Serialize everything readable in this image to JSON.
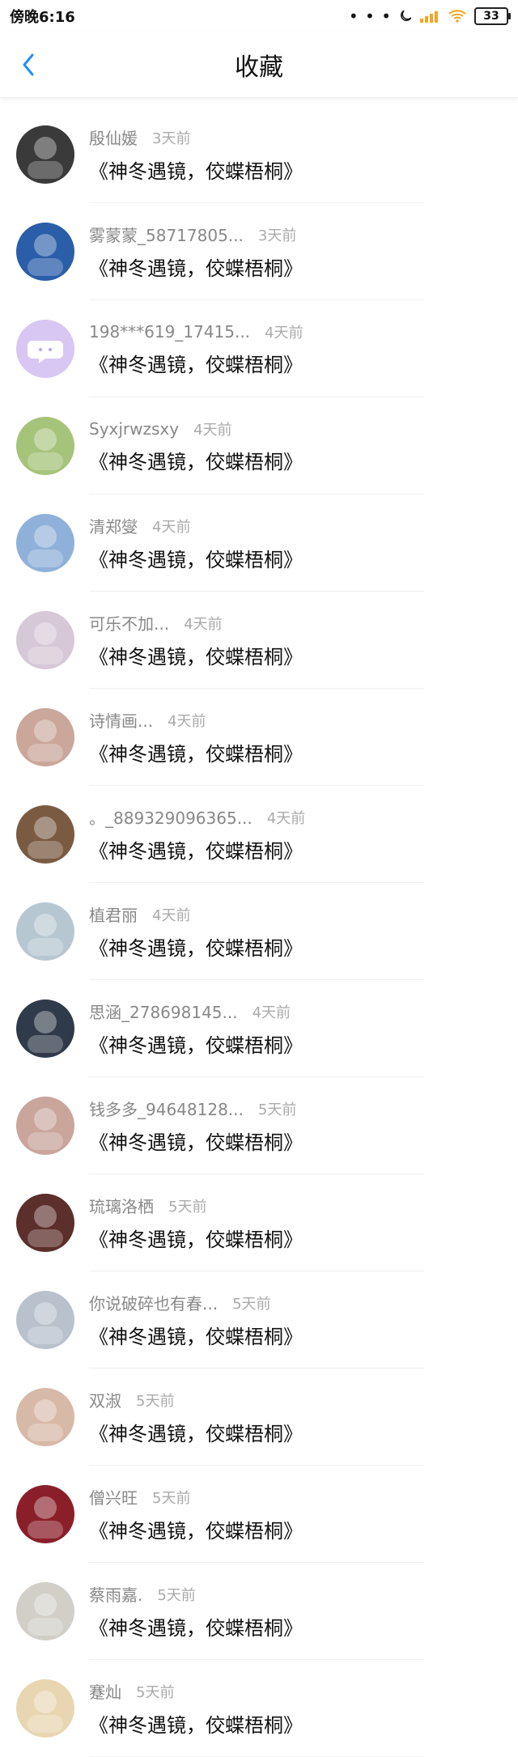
{
  "status_bar": {
    "time": "傍晚6:16",
    "battery": "33"
  },
  "header": {
    "title": "收藏"
  },
  "items": [
    {
      "name": "殷仙媛",
      "time": "3天前",
      "book": "《神冬遇镜，佼蝶梧桐》",
      "color": "#3a3a3a"
    },
    {
      "name": "雾蒙蒙_58717805...",
      "time": "3天前",
      "book": "《神冬遇镜，佼蝶梧桐》",
      "color": "#2a5ea8"
    },
    {
      "name": "198***619_17415...",
      "time": "4天前",
      "book": "《神冬遇镜，佼蝶梧桐》",
      "color": "#d7c7f2"
    },
    {
      "name": "Syxjrwzsxy",
      "time": "4天前",
      "book": "《神冬遇镜，佼蝶梧桐》",
      "color": "#a6c37a"
    },
    {
      "name": "清郑燮",
      "time": "4天前",
      "book": "《神冬遇镜，佼蝶梧桐》",
      "color": "#8fb1d9"
    },
    {
      "name": "可乐不加...",
      "time": "4天前",
      "book": "《神冬遇镜，佼蝶梧桐》",
      "color": "#d6c8d6"
    },
    {
      "name": "诗情画...",
      "time": "4天前",
      "book": "《神冬遇镜，佼蝶梧桐》",
      "color": "#caa79a"
    },
    {
      "name": "。_889329096365...",
      "time": "4天前",
      "book": "《神冬遇镜，佼蝶梧桐》",
      "color": "#7a5b42"
    },
    {
      "name": "植君丽",
      "time": "4天前",
      "book": "《神冬遇镜，佼蝶梧桐》",
      "color": "#b7c7d2"
    },
    {
      "name": "思涵_278698145...",
      "time": "4天前",
      "book": "《神冬遇镜，佼蝶梧桐》",
      "color": "#2f3b4a"
    },
    {
      "name": "钱多多_94648128...",
      "time": "5天前",
      "book": "《神冬遇镜，佼蝶梧桐》",
      "color": "#c9a59b"
    },
    {
      "name": "琉璃洛栖",
      "time": "5天前",
      "book": "《神冬遇镜，佼蝶梧桐》",
      "color": "#5b2f2b"
    },
    {
      "name": "你说破碎也有春...",
      "time": "5天前",
      "book": "《神冬遇镜，佼蝶梧桐》",
      "color": "#b9c1cc"
    },
    {
      "name": "双淑",
      "time": "5天前",
      "book": "《神冬遇镜，佼蝶梧桐》",
      "color": "#d7b9a8"
    },
    {
      "name": "僧兴旺",
      "time": "5天前",
      "book": "《神冬遇镜，佼蝶梧桐》",
      "color": "#8a1f2a"
    },
    {
      "name": "蔡雨嘉.",
      "time": "5天前",
      "book": "《神冬遇镜，佼蝶梧桐》",
      "color": "#d2cfc9"
    },
    {
      "name": "蹇灿",
      "time": "5天前",
      "book": "《神冬遇镜，佼蝶梧桐》",
      "color": "#e8d6b2"
    }
  ]
}
